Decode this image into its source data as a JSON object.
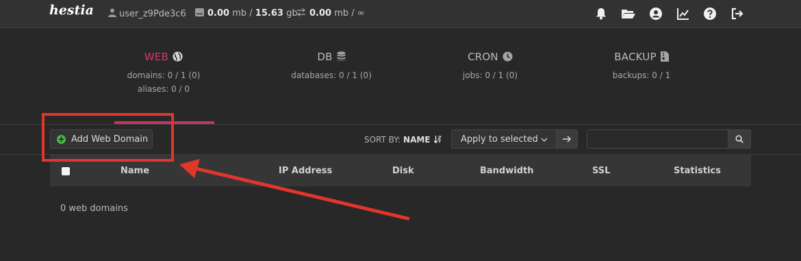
{
  "header": {
    "logo_text": "hestia",
    "username": "user_z9Pde3c6",
    "disk_used": "0.00",
    "disk_used_unit": "mb",
    "disk_total": "15.63",
    "disk_total_unit": "gb",
    "bw_used": "0.00",
    "bw_used_unit": "mb",
    "bw_total": "∞",
    "icons": [
      "bell-icon",
      "folder-icon",
      "user-circle-icon",
      "chart-line-icon",
      "help-icon",
      "logout-icon"
    ]
  },
  "tabs": [
    {
      "title": "WEB",
      "icon": "globe-icon",
      "lines": [
        "domains: 0 / 1 (0)",
        "aliases: 0 / 0"
      ],
      "active": true
    },
    {
      "title": "DB",
      "icon": "database-icon",
      "lines": [
        "databases: 0 / 1 (0)"
      ],
      "active": false
    },
    {
      "title": "CRON",
      "icon": "clock-icon",
      "lines": [
        "jobs: 0 / 1 (0)"
      ],
      "active": false
    },
    {
      "title": "BACKUP",
      "icon": "file-archive-icon",
      "lines": [
        "backups: 0 / 1"
      ],
      "active": false
    }
  ],
  "toolbar": {
    "add_label": "Add Web Domain",
    "sort_by_label": "SORT BY:",
    "sort_field": "NAME",
    "apply_select": "Apply to selected",
    "search_placeholder": ""
  },
  "table": {
    "columns": [
      "Name",
      "IP Address",
      "Disk",
      "Bandwidth",
      "SSL",
      "Statistics"
    ],
    "empty_text": "0 web domains"
  },
  "colors": {
    "accent": "#d1396d",
    "annotation_red": "#e0362b",
    "add_icon_green": "#49b54c"
  }
}
